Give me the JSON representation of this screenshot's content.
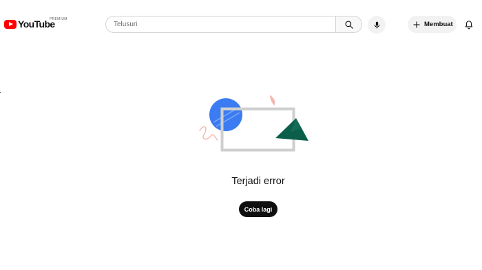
{
  "header": {
    "logo_text": "YouTube",
    "logo_country": "PREMIUM",
    "search_placeholder": "Telusuri",
    "search_value": "",
    "create_label": "Membuat"
  },
  "icons": {
    "logo": "youtube-logo-icon",
    "search": "search-icon",
    "mic": "microphone-icon",
    "create": "plus-icon",
    "notifications": "bell-icon",
    "illustration": "error-illustration"
  },
  "error": {
    "title": "Terjadi error",
    "retry_label": "Coba lagi"
  },
  "colors": {
    "brand_red": "#ff0000",
    "text": "#0f0f0f",
    "retry_button_bg": "#0f0f0f",
    "illustration_blue": "#3b7cf2",
    "illustration_green": "#0b5e4a",
    "illustration_pink": "#f4b6ae",
    "illustration_frame": "#cfcfcf"
  }
}
